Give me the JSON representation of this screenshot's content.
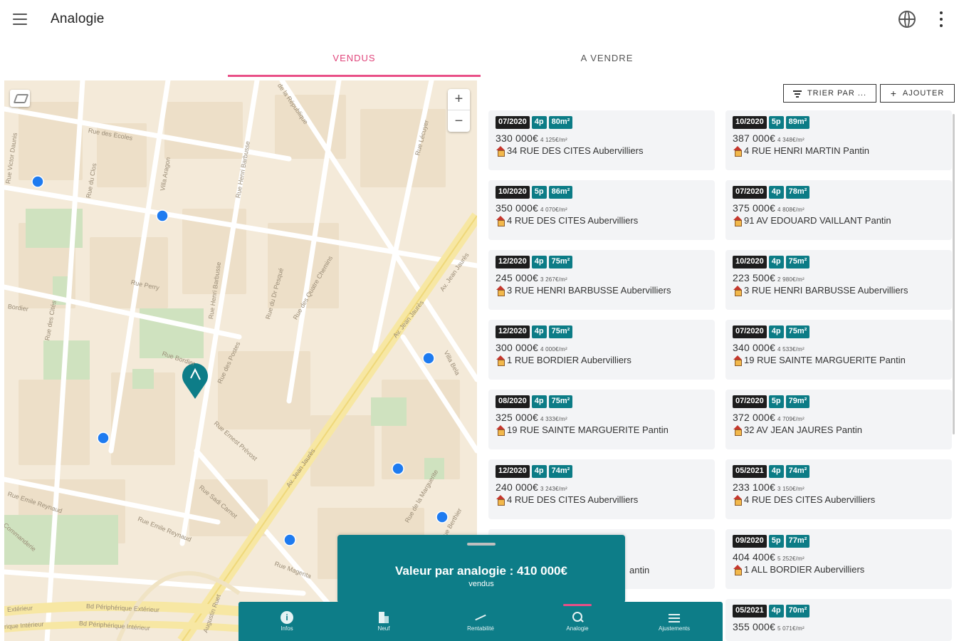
{
  "app": {
    "title": "Analogie"
  },
  "tabs": [
    {
      "label": "VENDUS",
      "active": true
    },
    {
      "label": "A VENDRE",
      "active": false
    }
  ],
  "toolbar": {
    "sort_label": "TRIER PAR ...",
    "add_label": "AJOUTER"
  },
  "map": {
    "zoom_in": "+",
    "zoom_out": "−",
    "streets": [
      "Rue des Ecoles",
      "Rue Victor Daunis",
      "Rue du Clos",
      "Villa Aragon",
      "Rue Henri Barbusse",
      "de la République",
      "Rue Lécuyer",
      "Rue Henri Barbusse",
      "Rue Perry",
      "Bordier",
      "Rue des Cités",
      "Rue Bordier",
      "Rue des Postes",
      "Rue du Dr Pesqué",
      "Rue des Quatre Chemins",
      "Av. Jean Jaurès",
      "Av. Jean Jaurès",
      "Villa Bela",
      "Rue Ernest Prévost",
      "Rue Sadi Carnot",
      "Rue Emile Reynaud",
      "Rue Emile Reynaud",
      "Rue Magenta",
      "Av. Jean Jaurès",
      "Rue Berthier",
      "Commanderie",
      "Bd Périphérique Extérieur",
      "Bd Périphérique Intérieur",
      "Extérieur",
      "rique Intérieur",
      "Augustin Ruet",
      "Rue de la Marguerite"
    ],
    "accent_color": "#0d7d88",
    "marker_color": "#1e7bf0"
  },
  "listings": [
    {
      "date": "07/2020",
      "rooms": "4p",
      "area": "80m²",
      "price": "330 000€",
      "price_per_m2": "4 125€/m²",
      "address": "34 RUE DES CITES Aubervilliers"
    },
    {
      "date": "10/2020",
      "rooms": "5p",
      "area": "89m²",
      "price": "387 000€",
      "price_per_m2": "4 348€/m²",
      "address": "4 RUE HENRI MARTIN Pantin"
    },
    {
      "date": "10/2020",
      "rooms": "5p",
      "area": "86m²",
      "price": "350 000€",
      "price_per_m2": "4 070€/m²",
      "address": "4 RUE DES CITES Aubervilliers"
    },
    {
      "date": "07/2020",
      "rooms": "4p",
      "area": "78m²",
      "price": "375 000€",
      "price_per_m2": "4 808€/m²",
      "address": "91 AV EDOUARD VAILLANT Pantin"
    },
    {
      "date": "12/2020",
      "rooms": "4p",
      "area": "75m²",
      "price": "245 000€",
      "price_per_m2": "3 267€/m²",
      "address": "3 RUE HENRI BARBUSSE Aubervilliers"
    },
    {
      "date": "10/2020",
      "rooms": "4p",
      "area": "75m²",
      "price": "223 500€",
      "price_per_m2": "2 980€/m²",
      "address": "3 RUE HENRI BARBUSSE Aubervilliers"
    },
    {
      "date": "12/2020",
      "rooms": "4p",
      "area": "75m²",
      "price": "300 000€",
      "price_per_m2": "4 000€/m²",
      "address": "1 RUE BORDIER Aubervilliers"
    },
    {
      "date": "07/2020",
      "rooms": "4p",
      "area": "75m²",
      "price": "340 000€",
      "price_per_m2": "4 533€/m²",
      "address": "19 RUE SAINTE MARGUERITE Pantin"
    },
    {
      "date": "08/2020",
      "rooms": "4p",
      "area": "75m²",
      "price": "325 000€",
      "price_per_m2": "4 333€/m²",
      "address": "19 RUE SAINTE MARGUERITE Pantin"
    },
    {
      "date": "07/2020",
      "rooms": "5p",
      "area": "79m²",
      "price": "372 000€",
      "price_per_m2": "4 709€/m²",
      "address": "32 AV JEAN JAURES Pantin"
    },
    {
      "date": "12/2020",
      "rooms": "4p",
      "area": "74m²",
      "price": "240 000€",
      "price_per_m2": "3 243€/m²",
      "address": "4 RUE DES CITES Aubervilliers"
    },
    {
      "date": "05/2021",
      "rooms": "4p",
      "area": "74m²",
      "price": "233 100€",
      "price_per_m2": "3 150€/m²",
      "address": "4 RUE DES CITES Aubervilliers"
    },
    {
      "date": "",
      "rooms": "",
      "area": "",
      "price": "",
      "price_per_m2": "",
      "address": "antin"
    },
    {
      "date": "09/2020",
      "rooms": "5p",
      "area": "77m²",
      "price": "404 400€",
      "price_per_m2": "5 252€/m²",
      "address": "1 ALL BORDIER Aubervilliers"
    },
    {
      "date": "",
      "rooms": "",
      "area": "",
      "price": "",
      "price_per_m2": "",
      "address": ""
    },
    {
      "date": "05/2021",
      "rooms": "4p",
      "area": "70m²",
      "price": "355 000€",
      "price_per_m2": "5 071€/m²",
      "address": ""
    }
  ],
  "valuation": {
    "value": "Valeur par analogie : 410 000€",
    "subtitle": "vendus"
  },
  "bottom_nav": [
    {
      "label": "Infos",
      "icon": "info-icon",
      "active": false
    },
    {
      "label": "Neuf",
      "icon": "building-icon",
      "active": false
    },
    {
      "label": "Rentabilité",
      "icon": "trending-up-icon",
      "active": false
    },
    {
      "label": "Analogie",
      "icon": "search-icon",
      "active": true
    },
    {
      "label": "Ajustements",
      "icon": "tune-icon",
      "active": false
    }
  ]
}
